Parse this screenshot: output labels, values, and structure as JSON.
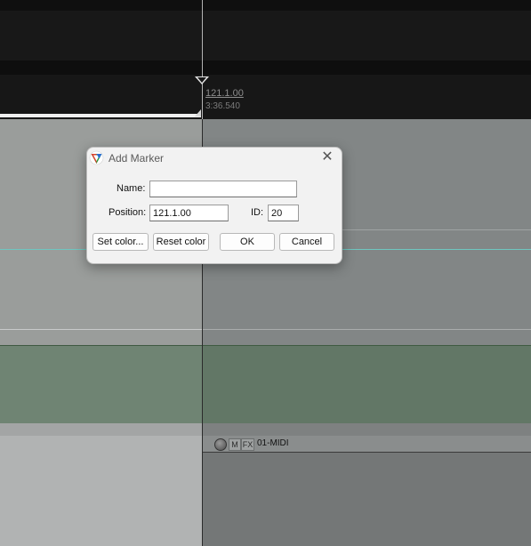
{
  "timeline": {
    "marker_position": "121.1.00",
    "marker_time": "3:36.540"
  },
  "track": {
    "mute_label": "M",
    "fx_label": "FX",
    "name": "01-MIDI"
  },
  "dialog": {
    "title": "Add Marker",
    "close_glyph": "✕",
    "name_label": "Name:",
    "name_value": "",
    "position_label": "Position:",
    "position_value": "121.1.00",
    "id_label": "ID:",
    "id_value": "20",
    "set_color_label": "Set color...",
    "reset_color_label": "Reset color",
    "ok_label": "OK",
    "cancel_label": "Cancel"
  },
  "colors": {
    "playhead": "#cfcfcf",
    "guide_cyan": "#6fc6c0",
    "dialog_bg": "#f2f2f2"
  },
  "icons": {
    "dialog_icon": "reaper-logo-icon",
    "close_icon": "close-icon",
    "marker_icon": "marker-triangle-icon",
    "record_arm_icon": "record-arm-icon"
  }
}
